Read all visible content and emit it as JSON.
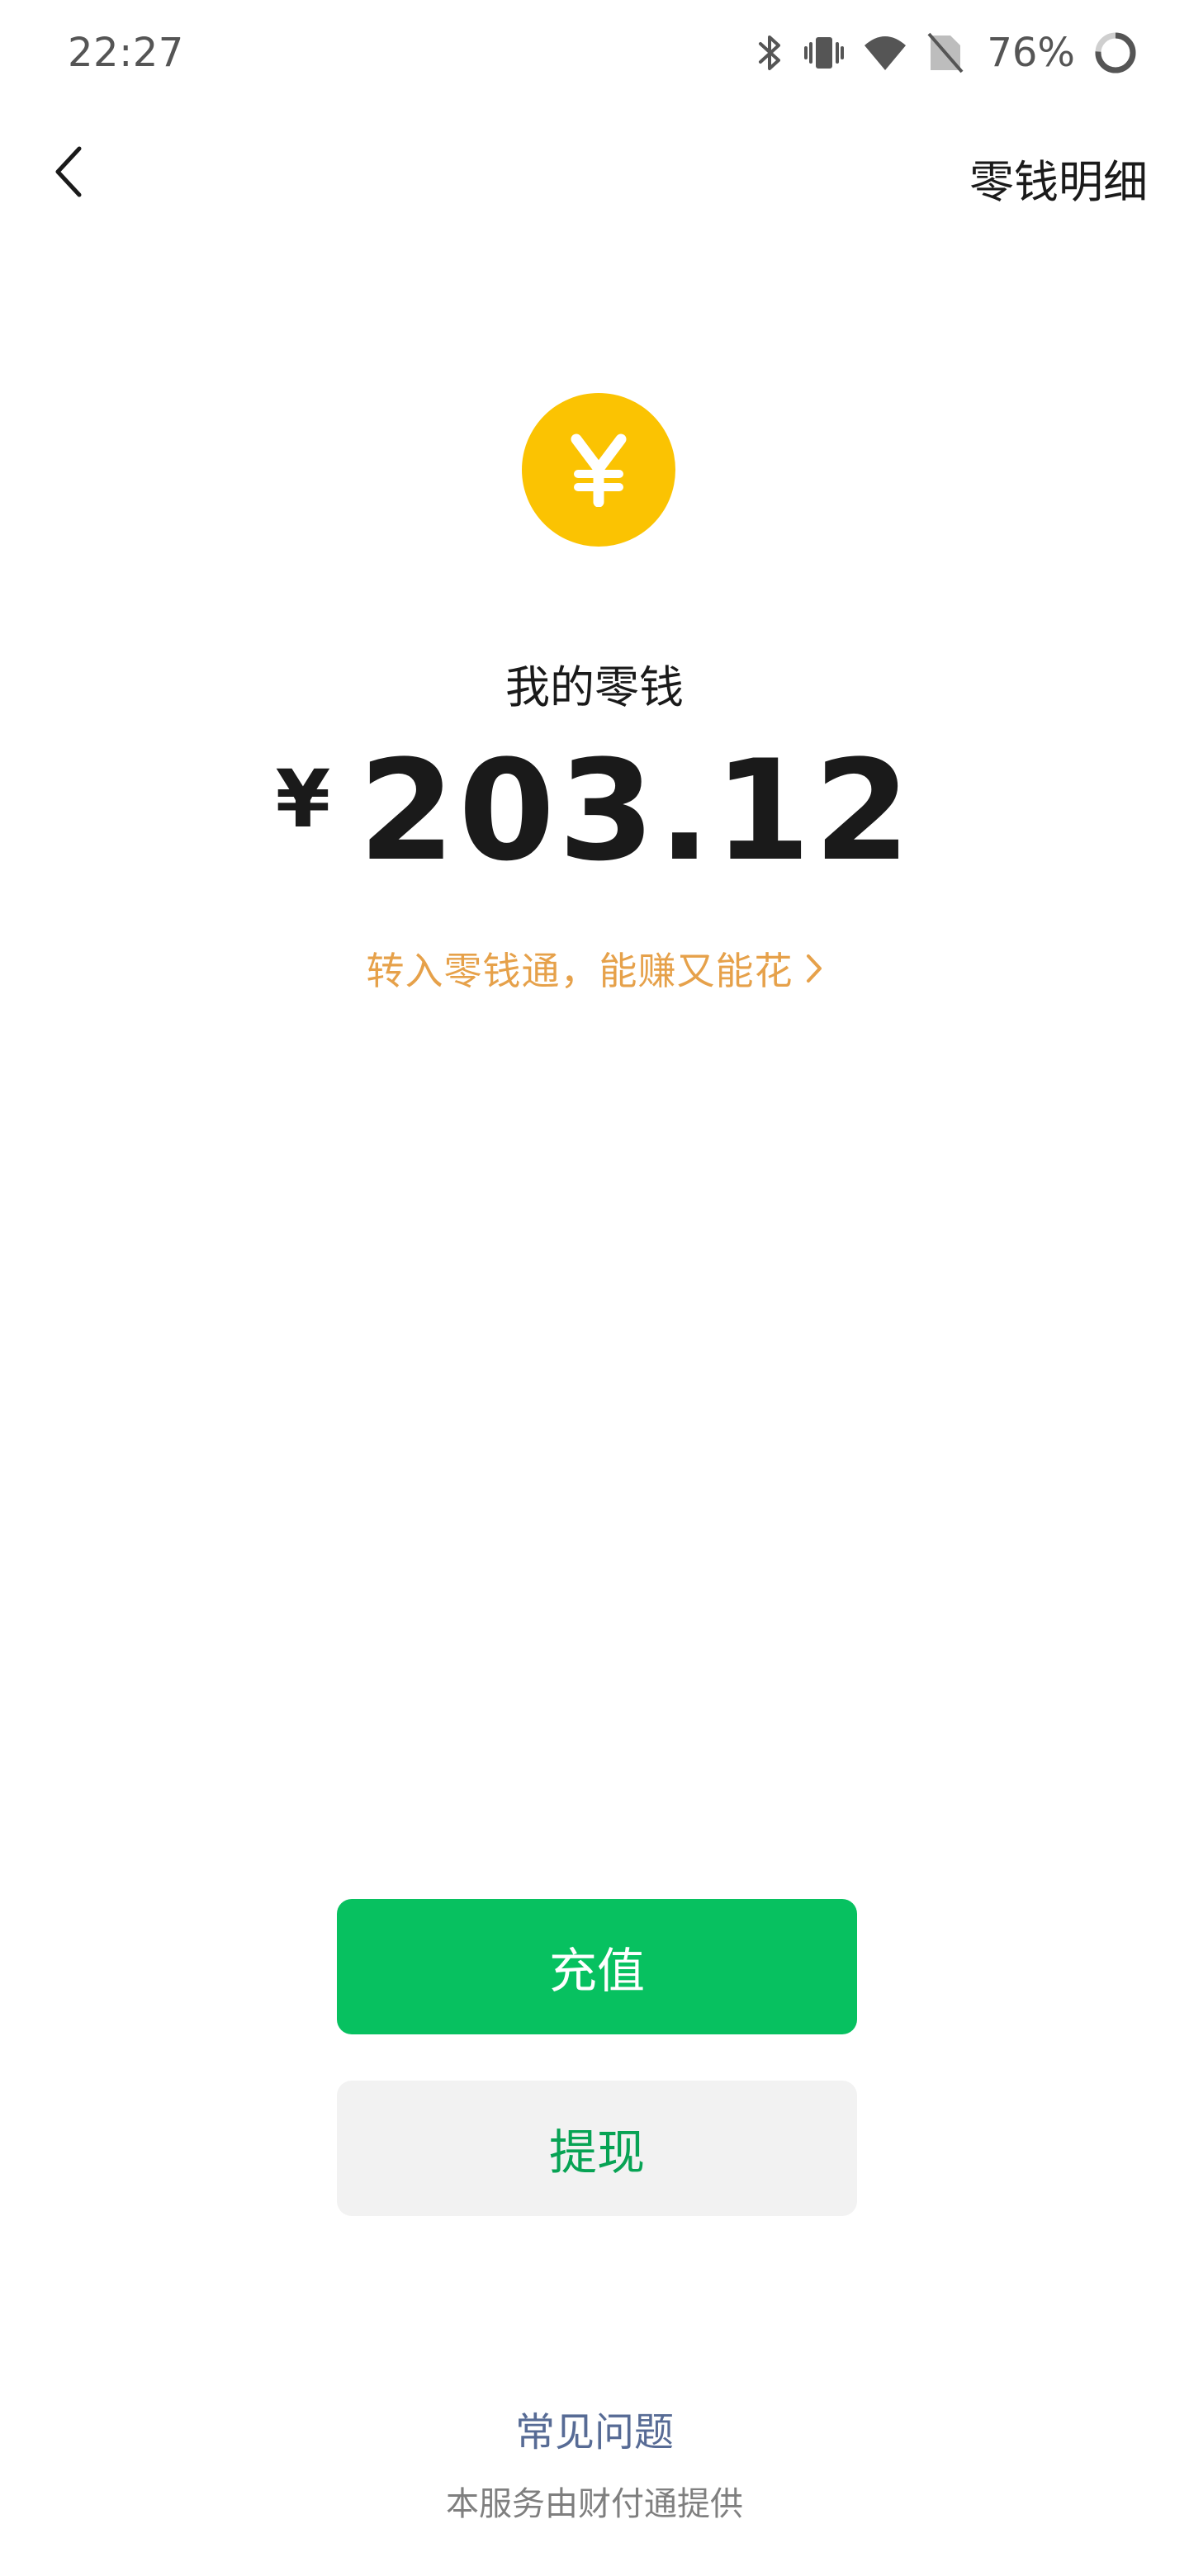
{
  "status_bar": {
    "time": "22:27",
    "battery_percent": "76%",
    "icons": [
      "bluetooth-icon",
      "vibrate-icon",
      "wifi-icon",
      "no-sim-icon",
      "battery-ring-icon"
    ]
  },
  "nav": {
    "back_icon": "chevron-left-icon",
    "detail_label": "零钱明细"
  },
  "wallet": {
    "coin_symbol": "¥",
    "label": "我的零钱",
    "currency": "¥",
    "balance": "203.12",
    "promo_text": "转入零钱通，能赚又能花",
    "promo_icon": "chevron-right-icon"
  },
  "actions": {
    "topup_label": "充值",
    "withdraw_label": "提现"
  },
  "footer": {
    "faq_label": "常见问题",
    "provider_note": "本服务由财付通提供"
  },
  "colors": {
    "coin": "#fbc302",
    "primary_green": "#07c160",
    "promo_orange": "#e6a14a",
    "link_blue": "#576b95"
  }
}
